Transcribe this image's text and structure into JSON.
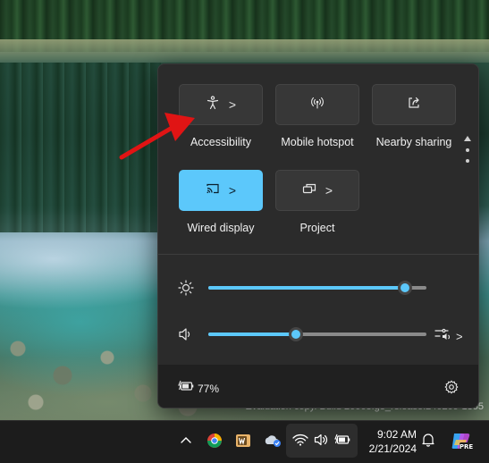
{
  "quick_settings": {
    "tiles": [
      {
        "label": "Accessibility",
        "icon": "accessibility-icon",
        "has_chevron": true,
        "active": false
      },
      {
        "label": "Mobile hotspot",
        "icon": "hotspot-icon",
        "has_chevron": false,
        "active": false
      },
      {
        "label": "Nearby sharing",
        "icon": "share-icon",
        "has_chevron": false,
        "active": false
      },
      {
        "label": "Wired display",
        "icon": "cast-icon",
        "has_chevron": true,
        "active": true
      },
      {
        "label": "Project",
        "icon": "project-icon",
        "has_chevron": true,
        "active": false
      }
    ],
    "chevron_glyph": ">",
    "brightness": {
      "icon": "brightness-icon",
      "value": 0.9
    },
    "volume": {
      "icon": "volume-icon",
      "value": 0.4
    },
    "audio_output": {
      "icon": "audio-output-icon"
    },
    "battery": {
      "icon": "battery-charging-icon",
      "text": "77%"
    },
    "settings": {
      "icon": "gear-icon"
    },
    "accent_color": "#5cc8fb"
  },
  "watermark": {
    "text": "Evaluation copy. Build 26063.ge_release.240209-1355"
  },
  "taskbar": {
    "overflow_icon": "chevron-up-icon",
    "apps": [
      "chrome-icon",
      "word-icon",
      "onedrive-icon"
    ],
    "tray": [
      "wifi-icon",
      "speaker-icon",
      "battery-icon"
    ],
    "time": "9:02 AM",
    "date": "2/21/2024",
    "notifications_icon": "bell-icon",
    "copilot": {
      "icon": "copilot-icon",
      "badge": "PRE"
    }
  }
}
